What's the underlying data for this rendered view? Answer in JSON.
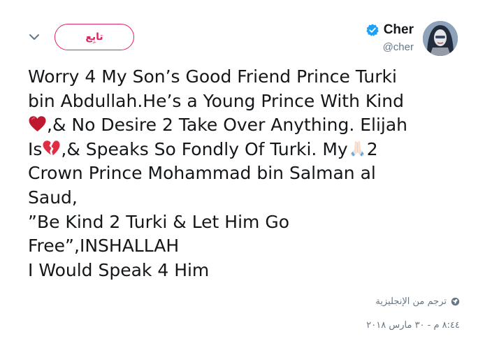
{
  "header": {
    "follow_label": "تابِع",
    "display_name": "Cher",
    "handle": "@cher"
  },
  "tweet": {
    "line1": "Worry 4 My Son’s Good Friend Prince Turki",
    "line2": "bin Abdullah.He’s a Young Prince With Kind",
    "line3_after_heart": ",& No Desire 2 Take Over Anything. Elijah",
    "line4_before_broken": "Is",
    "line4_mid": ",& Speaks So Fondly Of Turki. My",
    "line4_after_pray": "2",
    "line5": "Crown Prince Mohammad bin Salman al",
    "line6": "Saud,",
    "line7": "”Be Kind 2 Turki & Let Him Go",
    "line8": "Free”,INSHALLAH",
    "line9": "I Would Speak 4 Him"
  },
  "icons": {
    "heart": "red-heart-icon",
    "broken_heart": "broken-heart-icon",
    "pray": "folded-hands-icon",
    "verified": "verified-badge-icon",
    "caret": "chevron-down-icon",
    "globe": "globe-icon"
  },
  "footer": {
    "translate_label": "ترجم من الإنجليزية",
    "timestamp": "٨:٤٤ م - ٣٠ مارس ٢٠١٨"
  },
  "colors": {
    "accent": "#e0245e",
    "verified": "#1da1f2",
    "muted": "#657786",
    "text": "#14171a"
  }
}
